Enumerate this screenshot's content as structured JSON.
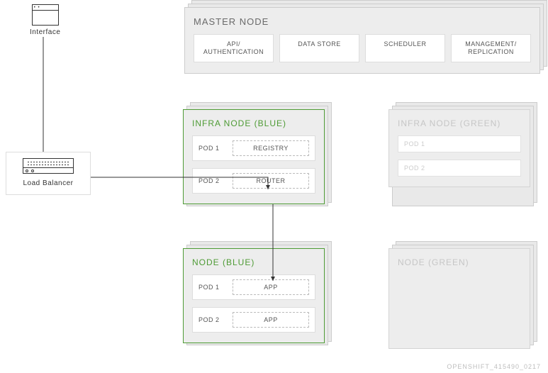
{
  "interface": {
    "label": "Interface"
  },
  "load_balancer": {
    "label": "Load Balancer"
  },
  "master": {
    "title": "MASTER NODE",
    "cells": [
      "API/\nAUTHENTICATION",
      "DATA STORE",
      "SCHEDULER",
      "MANAGEMENT/\nREPLICATION"
    ]
  },
  "infra_blue": {
    "title": "INFRA NODE (BLUE)",
    "pods": [
      {
        "label": "POD 1",
        "app": "REGISTRY"
      },
      {
        "label": "POD 2",
        "app": "ROUTER"
      }
    ]
  },
  "node_blue": {
    "title": "NODE (BLUE)",
    "pods": [
      {
        "label": "POD 1",
        "app": "APP"
      },
      {
        "label": "POD 2",
        "app": "APP"
      }
    ]
  },
  "infra_green": {
    "title": "INFRA NODE (GREEN)",
    "pods": [
      {
        "label": "POD 1"
      },
      {
        "label": "POD 2"
      }
    ]
  },
  "node_green": {
    "title": "NODE (GREEN)"
  },
  "footer": "OPENSHIFT_415490_0217"
}
